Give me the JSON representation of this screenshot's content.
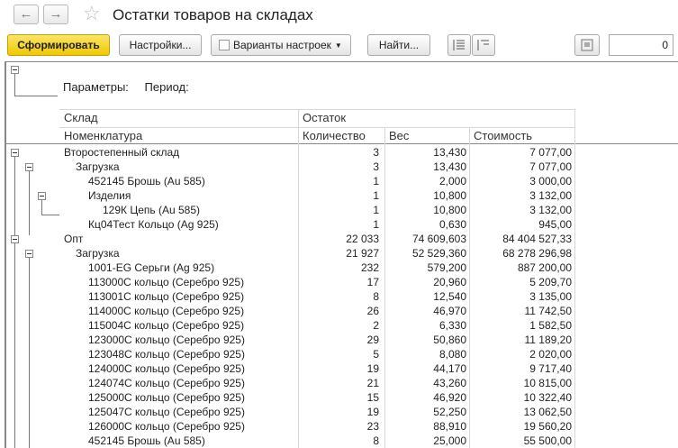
{
  "window": {
    "title": "Остатки товаров на складах"
  },
  "toolbar": {
    "back_glyph": "←",
    "forward_glyph": "→",
    "star_glyph": "☆",
    "generate_label": "Сформировать",
    "settings_label": "Настройки...",
    "variants_label": "Варианты настроек",
    "find_label": "Найти...",
    "counter_value": "0"
  },
  "params": {
    "label": "Параметры:",
    "period_label": "Период:"
  },
  "columns": {
    "sklad": "Склад",
    "ostatok": "Остаток",
    "nomenklatura": "Номенклатура",
    "kolichestvo": "Количество",
    "ves": "Вес",
    "stoimost": "Стоимость"
  },
  "rows": [
    {
      "name": "Второстепенный склад",
      "qty": "3",
      "weight": "13,430",
      "cost": "7 077,00",
      "level": 0
    },
    {
      "name": "Загрузка",
      "qty": "3",
      "weight": "13,430",
      "cost": "7 077,00",
      "level": 1
    },
    {
      "name": "452145 Брошь (Au 585)",
      "qty": "1",
      "weight": "2,000",
      "cost": "3 000,00",
      "level": 2
    },
    {
      "name": "Изделия",
      "qty": "1",
      "weight": "10,800",
      "cost": "3 132,00",
      "level": 2
    },
    {
      "name": "129К Цепь (Au 585)",
      "qty": "1",
      "weight": "10,800",
      "cost": "3 132,00",
      "level": 3
    },
    {
      "name": "Кц04Тест Кольцо (Ag 925)",
      "qty": "1",
      "weight": "0,630",
      "cost": "945,00",
      "level": 2
    },
    {
      "name": "Опт",
      "qty": "22 033",
      "weight": "74 609,603",
      "cost": "84 404 527,33",
      "level": 0
    },
    {
      "name": "Загрузка",
      "qty": "21 927",
      "weight": "52 529,360",
      "cost": "68 278 296,98",
      "level": 1
    },
    {
      "name": "1001-EG Серьги (Ag 925)",
      "qty": "232",
      "weight": "579,200",
      "cost": "887 200,00",
      "level": 2
    },
    {
      "name": "113000С кольцо (Серебро 925)",
      "qty": "17",
      "weight": "20,960",
      "cost": "5 209,70",
      "level": 2
    },
    {
      "name": "113001С кольцо (Серебро 925)",
      "qty": "8",
      "weight": "12,540",
      "cost": "3 135,00",
      "level": 2
    },
    {
      "name": "114000С кольцо (Серебро 925)",
      "qty": "26",
      "weight": "46,970",
      "cost": "11 742,50",
      "level": 2
    },
    {
      "name": "115004С кольцо (Серебро 925)",
      "qty": "2",
      "weight": "6,330",
      "cost": "1 582,50",
      "level": 2
    },
    {
      "name": "123000С кольцо (Серебро 925)",
      "qty": "29",
      "weight": "50,860",
      "cost": "11 189,20",
      "level": 2
    },
    {
      "name": "123048С кольцо (Серебро 925)",
      "qty": "5",
      "weight": "8,080",
      "cost": "2 020,00",
      "level": 2
    },
    {
      "name": "124000С кольцо (Серебро 925)",
      "qty": "19",
      "weight": "44,170",
      "cost": "9 717,40",
      "level": 2
    },
    {
      "name": "124074С кольцо (Серебро 925)",
      "qty": "21",
      "weight": "43,260",
      "cost": "10 815,00",
      "level": 2
    },
    {
      "name": "125000С кольцо (Серебро 925)",
      "qty": "15",
      "weight": "46,920",
      "cost": "10 322,40",
      "level": 2
    },
    {
      "name": "125047С кольцо (Серебро 925)",
      "qty": "19",
      "weight": "52,250",
      "cost": "13 062,50",
      "level": 2
    },
    {
      "name": "126000С кольцо (Серебро 925)",
      "qty": "23",
      "weight": "88,910",
      "cost": "19 560,20",
      "level": 2
    },
    {
      "name": "452145 Брошь (Au 585)",
      "qty": "8",
      "weight": "25,000",
      "cost": "55 500,00",
      "level": 2
    }
  ]
}
